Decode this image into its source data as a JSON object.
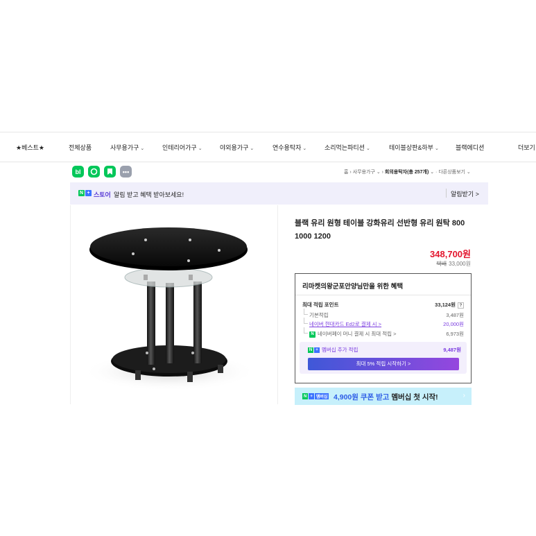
{
  "categories": [
    {
      "label": "★베스트★",
      "dropdown": false
    },
    {
      "label": "전체상품",
      "dropdown": false
    },
    {
      "label": "사무용가구",
      "dropdown": true
    },
    {
      "label": "인테리어가구",
      "dropdown": true
    },
    {
      "label": "야외용가구",
      "dropdown": true
    },
    {
      "label": "연수용탁자",
      "dropdown": true
    },
    {
      "label": "소리먹는파티션",
      "dropdown": true
    },
    {
      "label": "테이블상판&하부",
      "dropdown": true
    },
    {
      "label": "블랙에디션",
      "dropdown": false
    },
    {
      "label": "더보기",
      "dropdown": false
    }
  ],
  "social": {
    "blog": "bl"
  },
  "breadcrumb": {
    "home": "홈",
    "level1": "사무용가구",
    "level2": "회의용탁자(총 257개)",
    "more": "다른상품보기"
  },
  "alarm": {
    "store_label": "스토어",
    "message": "알림 받고 혜택 받아보세요!",
    "receive": "알림받기 >"
  },
  "product": {
    "title": "블랙 유리 원형 테이블 강화유리 선반형 유리 원탁 800 1000 1200",
    "price": "348,700원",
    "orig_prefix": "택배",
    "orig_price": "33,000원"
  },
  "benefit": {
    "heading": "리마켓의왕군포안양님만을 위한 혜택",
    "max_points_label": "최대 적립 포인트",
    "max_points_value": "33,124원",
    "question": "?",
    "basic_label": "기본적립",
    "basic_value": "3,487원",
    "card_label": "네이버 현대카드 Ed2로 결제 시 >",
    "card_value": "20,000원",
    "npay_label": "네이버페이 머니 결제 시 최대 적립 >",
    "npay_value": "6,973원",
    "member_label": "멤버십 추가 적립",
    "member_value": "9,487원",
    "member_button": "최대 5% 적립 시작하기 >"
  },
  "coupon": {
    "badge": "멤버십",
    "amount": "4,900원 쿠폰 받고",
    "rest": " 멤버십 첫 시작!",
    "arrow": "›"
  },
  "colors": {
    "naver_green": "#03c75a",
    "price_red": "#e3152d",
    "purple": "#7b3ce0",
    "alarm_bg": "#f0effb",
    "coupon_bg": "#c7f0fb"
  }
}
